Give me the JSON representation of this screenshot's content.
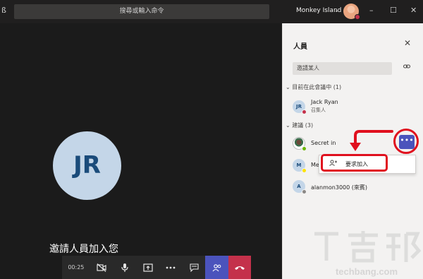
{
  "titlebar": {
    "left_glyph": "ß",
    "search_placeholder": "搜尋或輸入命令",
    "org_name": "Monkey Island",
    "org_chevron": "⌄",
    "minimize": "–",
    "maximize": "☐",
    "close": "✕",
    "presence_color": "#c4314b"
  },
  "stage": {
    "avatar_initials": "JR",
    "invite_message": "邀請人員加入您"
  },
  "controls": {
    "timer": "00:25",
    "camera_icon": "camera-off-icon",
    "mic_icon": "microphone-icon",
    "share_icon": "share-screen-icon",
    "more_icon": "more-icon",
    "chat_icon": "chat-icon",
    "people_icon": "people-icon",
    "hangup_icon": "hang-up-icon",
    "hangup_color": "#c4314b",
    "people_color": "#4b53bc"
  },
  "panel": {
    "title": "人員",
    "close": "✕",
    "invite_placeholder": "邀請某人",
    "section_in_meeting": "目前在此會議中 (1)",
    "section_suggested": "建議 (3)",
    "attendees": [
      {
        "initials": "JR",
        "name": "Jack Ryan",
        "role": "召集人",
        "status_color": "#c4314b"
      }
    ],
    "suggestions": [
      {
        "name": "Secret in",
        "status_color": "#6bb700"
      },
      {
        "initials": "M",
        "name": "Me",
        "status_color": "#fde300"
      },
      {
        "initials": "A",
        "name": "alanmon3000 (來賓)",
        "status_color": "#8a8886"
      }
    ],
    "more_button": "•••",
    "menu_item_icon": "add-person-icon",
    "menu_item_label": "要求加入"
  },
  "annotation_color": "#e0101e",
  "watermark": {
    "text_top": "T套邦",
    "text_bottom": "techbang.com"
  }
}
